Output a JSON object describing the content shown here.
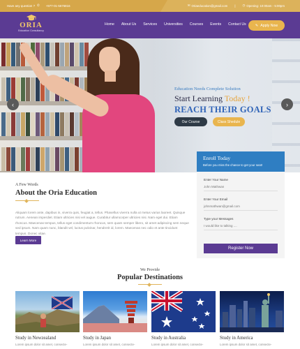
{
  "topbar": {
    "question": "Have any question ?",
    "phone": "+977-01-5676816",
    "email": "Oriaeducation@gmail.com",
    "opening": "Opening: 10:00am - 5:00pm"
  },
  "brand": {
    "name": "ORIA",
    "tagline": "Education Consultancy"
  },
  "nav": {
    "items": [
      "Home",
      "About Us",
      "Services",
      "Universities",
      "Courses",
      "Events",
      "Contact Us"
    ],
    "apply_label": "Apply Now"
  },
  "hero": {
    "eyebrow": "Education Needs Complete Solution",
    "line1_prefix": "Start Learning ",
    "line1_highlight": "Today !",
    "line2": "REACH THEIR GOALS",
    "btn_course": "Our Course",
    "btn_schedule": "Class Shedule",
    "prev_icon": "chevron-left-icon",
    "next_icon": "chevron-right-icon"
  },
  "about": {
    "kicker": "A Few Words",
    "title": "About the Oria Education",
    "text": "Aliquam lorem ante, dapibus in, viverra quis, feugiat a, tellus. Phasellus viverra nulla ut metus varius laoreet. Quisque rutrum. Aenean imperdiet. Etiam ultricies nisi vel augue. Curabitur ullamcorper ultricies nisi. Nam eget dui. Etiam rhoncus. Maecenas tempus, tellus eget condimentum rhoncus, sem quam semper libero, sit amet adipiscing sem neque sed ipsum. Nam quam nunc, blandit vel, luctus pulvinar, hendrerit id, lorem. Maecenas nec odio et ante tincidunt tempus. Donec vitae.",
    "button": "Learn More"
  },
  "enroll": {
    "title": "Enroll Today",
    "subtitle": "Before you miss the chance to get your seat!",
    "name_label": "Enter Your Name",
    "name_value": "John Mathwan",
    "email_label": "Enter Your Email",
    "email_value": "johnmathwan@gmail.com",
    "subject_label": "Type your Messages",
    "subject_value": "I would like to talking ....",
    "submit": "Register Now"
  },
  "destinations": {
    "kicker": "We Provide",
    "title": "Popular Destinations",
    "cards": [
      {
        "title": "Study in Newzealand",
        "text": "Lorem ipsum dolor sit amet, consecte-"
      },
      {
        "title": "Study in Japan",
        "text": "Lorem ipsum dolor sit amet, consecte-"
      },
      {
        "title": "Study in Australia",
        "text": "Lorem ipsum dolor sit amet, consecte-"
      },
      {
        "title": "Study in America",
        "text": "Lorem ipsum dolor sit amet, consecte-"
      }
    ]
  },
  "colors": {
    "primary": "#5b3b93",
    "accent": "#e9b54e",
    "blue": "#2f7ec2",
    "heading_blue": "#2f63b7"
  }
}
